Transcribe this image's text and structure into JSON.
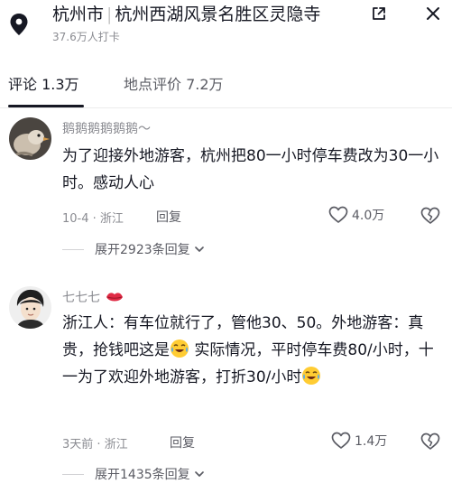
{
  "header": {
    "city": "杭州市",
    "place": "杭州西湖风景名胜区灵隐寺",
    "checkins": "37.6万人打卡"
  },
  "tabs": [
    {
      "label": "评论 1.3万"
    },
    {
      "label": "地点评价 7.2万"
    }
  ],
  "comments": [
    {
      "username": "鹅鹅鹅鹅鹅鹅～",
      "text": "为了迎接外地游客，杭州把80一小时停车费改为30一小时。感动人心",
      "date_location": "10-4 · 浙江",
      "reply_label": "回复",
      "likes": "4.0万",
      "expand_label": "展开2923条回复"
    },
    {
      "username": "七七七",
      "text_parts": [
        "浙江人：有车位就行了，管他30、50。外地游客：真贵，抢钱吧这是",
        " 实际情况，平时停车费80/小时，十一为了欢迎外地游客，打折30/小时"
      ],
      "date_location": "3天前 · 浙江",
      "reply_label": "回复",
      "likes": "1.4万",
      "expand_label": "展开1435条回复"
    }
  ],
  "icons": {
    "location": "location-pin-icon",
    "share": "share-icon",
    "close": "close-icon",
    "like": "heart-icon",
    "dislike": "broken-heart-icon",
    "chevron": "chevron-down-icon",
    "lips": "lips-icon",
    "cry": "crying-laughing-emoji"
  }
}
